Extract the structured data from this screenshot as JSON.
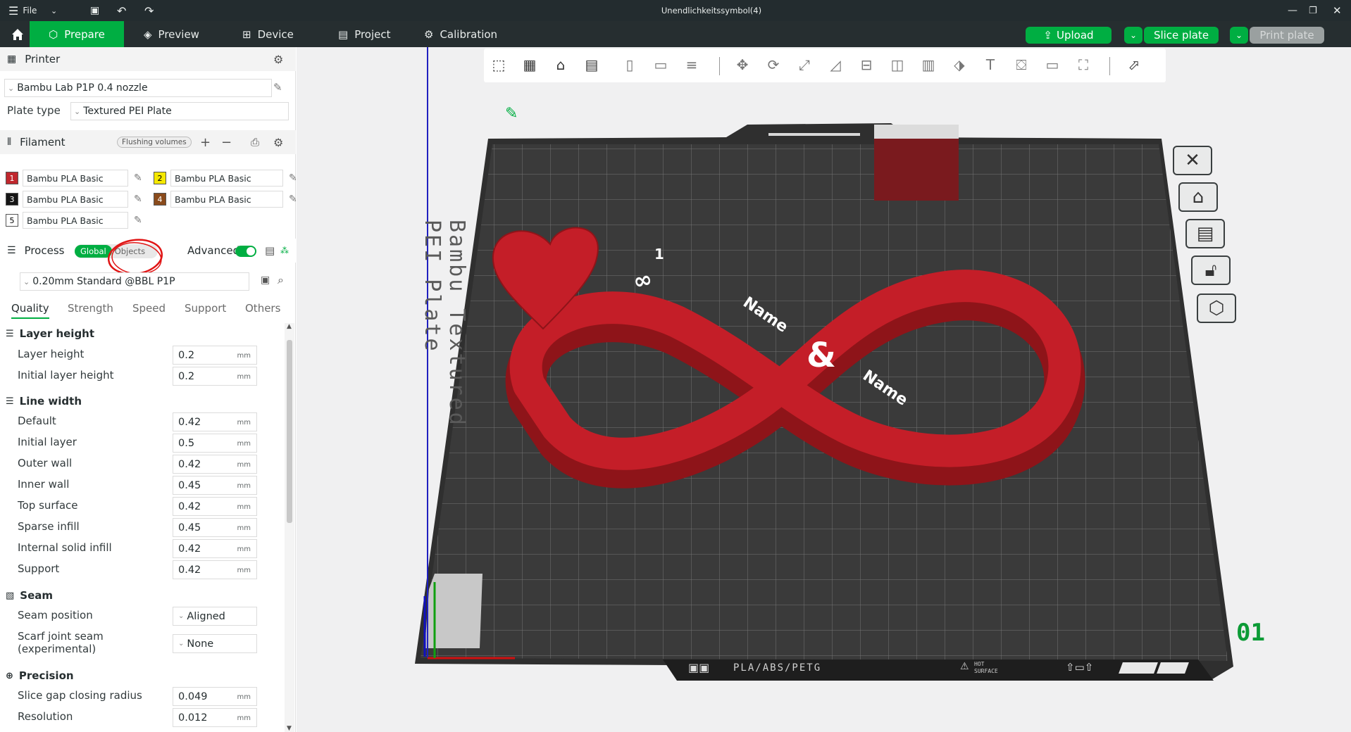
{
  "titlebar": {
    "menu_label": "File",
    "document_title": "Unendlichkeitssymbol(4)"
  },
  "tabs": [
    {
      "label": "Prepare"
    },
    {
      "label": "Preview"
    },
    {
      "label": "Device"
    },
    {
      "label": "Project"
    },
    {
      "label": "Calibration"
    }
  ],
  "actions": {
    "upload": "Upload",
    "slice_plate": "Slice plate",
    "print_plate": "Print plate"
  },
  "printer": {
    "section_label": "Printer",
    "selected": "Bambu Lab P1P 0.4 nozzle",
    "plate_type_label": "Plate type",
    "plate_type": "Textured PEI Plate"
  },
  "filament": {
    "section_label": "Filament",
    "flushing_label": "Flushing volumes",
    "items": [
      {
        "num": "1",
        "name": "Bambu PLA Basic",
        "color": "#c0272d"
      },
      {
        "num": "2",
        "name": "Bambu PLA Basic",
        "color": "#f5e800"
      },
      {
        "num": "3",
        "name": "Bambu PLA Basic",
        "color": "#161616"
      },
      {
        "num": "4",
        "name": "Bambu PLA Basic",
        "color": "#8a4b1c"
      },
      {
        "num": "5",
        "name": "Bambu PLA Basic",
        "color": "#ffffff"
      }
    ]
  },
  "process": {
    "section_label": "Process",
    "toggle_global": "Global",
    "toggle_objects": "Objects",
    "advanced_label": "Advanced",
    "preset": "0.20mm Standard @BBL P1P",
    "subtabs": [
      "Quality",
      "Strength",
      "Speed",
      "Support",
      "Others"
    ],
    "groups": {
      "layer_height": {
        "title": "Layer height",
        "rows": [
          {
            "label": "Layer height",
            "value": "0.2",
            "unit": "mm"
          },
          {
            "label": "Initial layer height",
            "value": "0.2",
            "unit": "mm"
          }
        ]
      },
      "line_width": {
        "title": "Line width",
        "rows": [
          {
            "label": "Default",
            "value": "0.42",
            "unit": "mm"
          },
          {
            "label": "Initial layer",
            "value": "0.5",
            "unit": "mm"
          },
          {
            "label": "Outer wall",
            "value": "0.42",
            "unit": "mm"
          },
          {
            "label": "Inner wall",
            "value": "0.45",
            "unit": "mm"
          },
          {
            "label": "Top surface",
            "value": "0.42",
            "unit": "mm"
          },
          {
            "label": "Sparse infill",
            "value": "0.45",
            "unit": "mm"
          },
          {
            "label": "Internal solid infill",
            "value": "0.42",
            "unit": "mm"
          },
          {
            "label": "Support",
            "value": "0.42",
            "unit": "mm"
          }
        ]
      },
      "seam": {
        "title": "Seam",
        "seam_position_label": "Seam position",
        "seam_position": "Aligned",
        "scarf_label_1": "Scarf joint seam",
        "scarf_label_2": "(experimental)",
        "scarf_value": "None"
      },
      "precision": {
        "title": "Precision",
        "rows": [
          {
            "label": "Slice gap closing radius",
            "value": "0.049",
            "unit": "mm"
          },
          {
            "label": "Resolution",
            "value": "0.012",
            "unit": "mm"
          }
        ]
      }
    }
  },
  "viewport": {
    "plate_text": "Bambu Textured PEI Plate",
    "plate_footer": "PLA/ABS/PETG",
    "hot_surface_1": "HOT",
    "hot_surface_2": "SURFACE",
    "plate_number": "01",
    "model_label_1": "Name",
    "model_label_2": "Name",
    "model_ampersand": "&",
    "heart_number": "1",
    "heart_infinity": "∞",
    "model_color": "#c41e28"
  }
}
